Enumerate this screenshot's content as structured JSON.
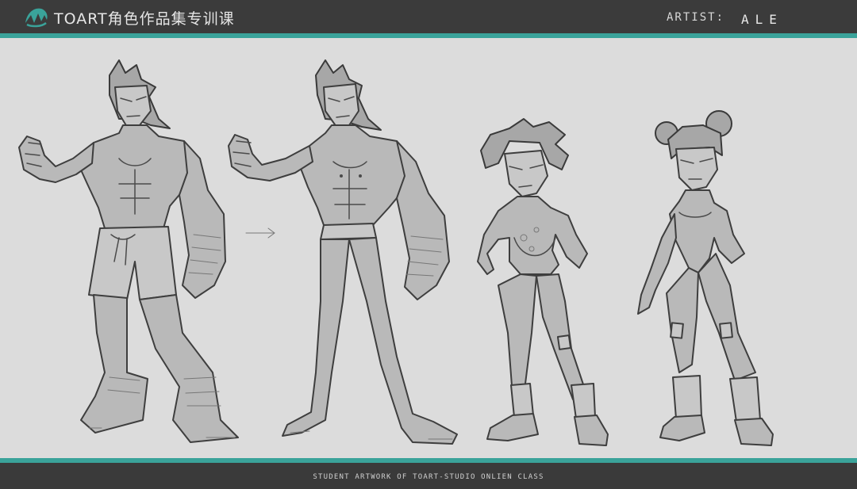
{
  "header": {
    "brand": "TOART角色作品集专训课",
    "artist_label": "ARTIST:",
    "artist_name": "ALE"
  },
  "footer": {
    "caption": "STUDENT ARTWORK OF TOART-STUDIO ONLIEN CLASS"
  },
  "colors": {
    "accent": "#3aa39a",
    "header_bg": "#3b3b3b",
    "canvas_bg": "#dcdcdc"
  },
  "artwork": {
    "figures": [
      "male-fighter-rough",
      "male-fighter-refined",
      "female-fighter-1",
      "female-fighter-2"
    ]
  }
}
